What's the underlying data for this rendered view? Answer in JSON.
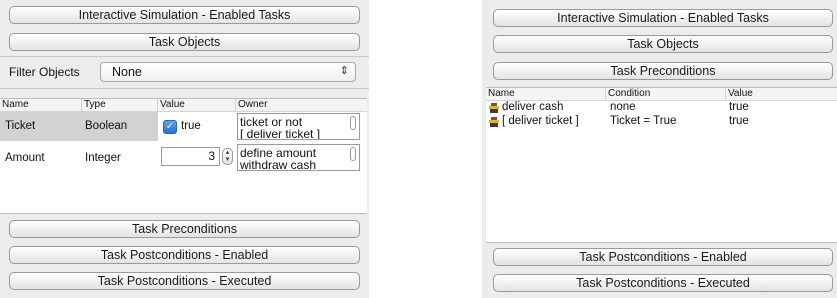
{
  "left": {
    "header_button": "Interactive Simulation - Enabled Tasks",
    "task_objects_button": "Task Objects",
    "filter": {
      "label": "Filter Objects",
      "value": "None"
    },
    "table": {
      "columns": [
        "Name",
        "Type",
        "Value",
        "Owner"
      ],
      "rows": [
        {
          "name": "Ticket",
          "type": "Boolean",
          "value": "true",
          "checked": true,
          "owner": "ticket or not\n[ deliver ticket ]"
        },
        {
          "name": "Amount",
          "type": "Integer",
          "value": "3",
          "owner": "define amount\nwithdraw cash"
        }
      ]
    },
    "preconditions_button": "Task Preconditions",
    "postconditions_enabled_button": "Task Postconditions - Enabled",
    "postconditions_executed_button": "Task Postconditions - Executed"
  },
  "right": {
    "header_button": "Interactive Simulation - Enabled Tasks",
    "task_objects_button": "Task Objects",
    "preconditions_button": "Task Preconditions",
    "table": {
      "columns": [
        "Name",
        "Condition",
        "Value"
      ],
      "rows": [
        {
          "name": "deliver cash",
          "condition": "none",
          "value": "true",
          "icon": "task-icon"
        },
        {
          "name": "[ deliver ticket ]",
          "condition": "Ticket = True",
          "value": "true",
          "icon": "task-icon"
        }
      ]
    },
    "postconditions_enabled_button": "Task Postconditions - Enabled",
    "postconditions_executed_button": "Task Postconditions - Executed"
  },
  "colors": {
    "panel_bg": "#ececec",
    "selected_row": "#d2d2d2",
    "checkbox_blue": "#2a6fd6"
  }
}
